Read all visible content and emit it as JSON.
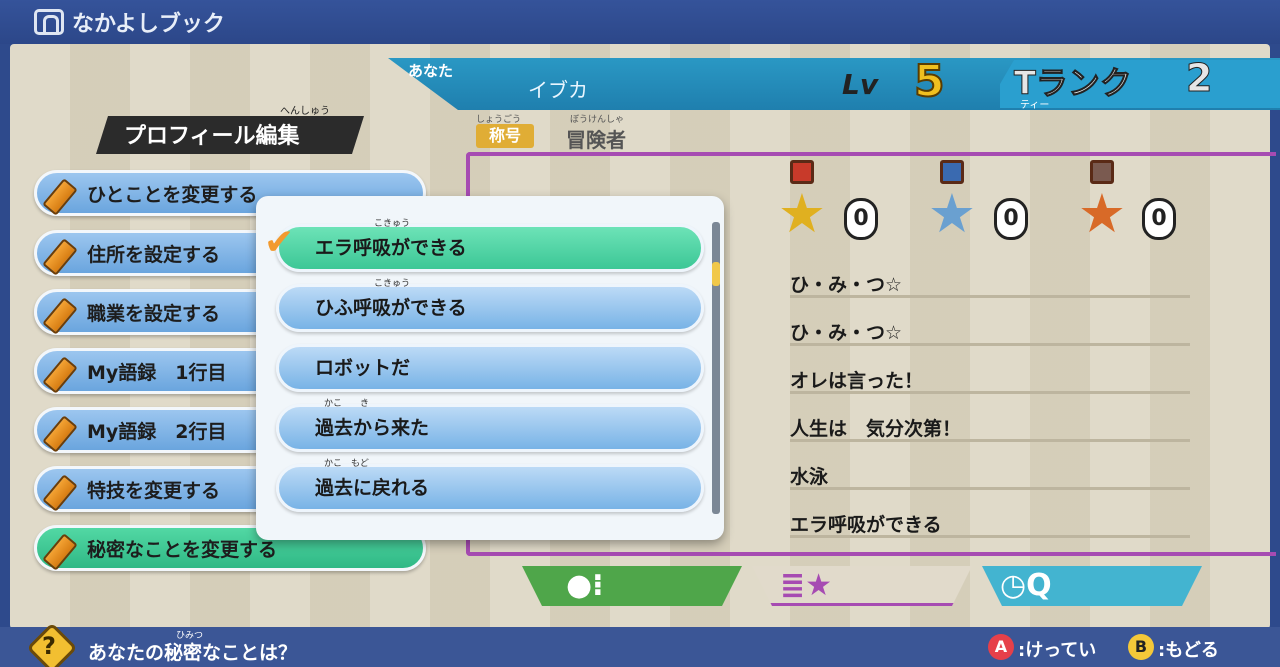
{
  "app": {
    "title": "なかよしブック"
  },
  "header": {
    "you_label": "あなた",
    "name": "イブカ",
    "lv_label": "Lv",
    "lv_value": "5",
    "rank_label": "Tランク",
    "rank_ruby": "ティー",
    "rank_value": "2",
    "title_tag": "称号",
    "title_tag_ruby": "しょうごう",
    "title_value": "冒険者",
    "title_value_ruby": "ぼうけんしゃ"
  },
  "sidebar": {
    "heading": "プロフィール編集",
    "heading_ruby": "へんしゅう",
    "items": [
      {
        "label": "ひとことを変更する",
        "active": false
      },
      {
        "label": "住所を設定する",
        "active": false
      },
      {
        "label": "職業を設定する",
        "active": false
      },
      {
        "label": "My語録　1行目",
        "active": false
      },
      {
        "label": "My語録　2行目",
        "active": false
      },
      {
        "label": "特技を変更する",
        "active": false
      },
      {
        "label": "秘密なことを変更する",
        "active": true
      }
    ]
  },
  "medals": [
    {
      "color": "#e0b020",
      "count": "0"
    },
    {
      "color": "#6aa0d0",
      "count": "0"
    },
    {
      "color": "#d86a28",
      "count": "0"
    }
  ],
  "info_rows": [
    "ひ・み・つ☆",
    "ひ・み・つ☆",
    "オレは言った！",
    "人生は　気分次第！",
    "水泳",
    "エラ呼吸ができる"
  ],
  "popup": {
    "options": [
      {
        "label": "エラ呼吸ができる",
        "ruby": "こきゅう",
        "selected": true
      },
      {
        "label": "ひふ呼吸ができる",
        "ruby": "こきゅう",
        "selected": false
      },
      {
        "label": "ロボットだ",
        "ruby": "",
        "selected": false
      },
      {
        "label": "過去から来た",
        "ruby": "かこ　　き",
        "selected": false
      },
      {
        "label": "過去に戻れる",
        "ruby": "かこ　もど",
        "selected": false
      }
    ]
  },
  "footer": {
    "question": "あなたの秘密なことは？",
    "question_ruby": "ひみつ",
    "confirm_key": "A",
    "confirm_label": ":けってい",
    "back_key": "B",
    "back_label": ":もどる"
  }
}
